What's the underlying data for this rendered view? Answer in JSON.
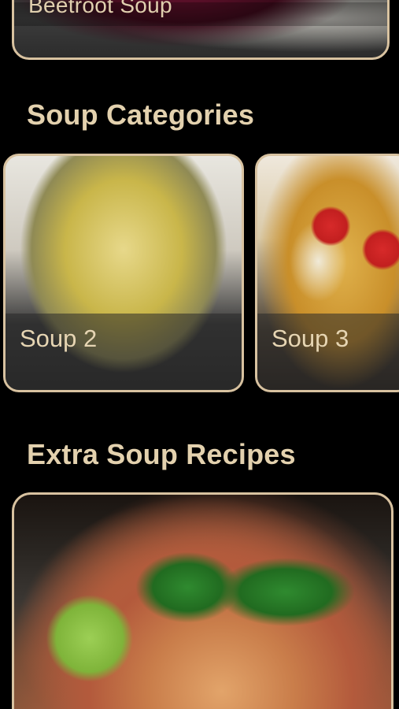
{
  "featured": {
    "title": "Beetroot Soup"
  },
  "sections": {
    "categories_title": "Soup Categories",
    "extra_title": "Extra Soup Recipes"
  },
  "categories": [
    {
      "label": "Soup 2"
    },
    {
      "label": "Soup 3"
    }
  ],
  "colors": {
    "background": "#000000",
    "accent_text": "#e3d1ae",
    "card_border": "#d8c2a0"
  }
}
